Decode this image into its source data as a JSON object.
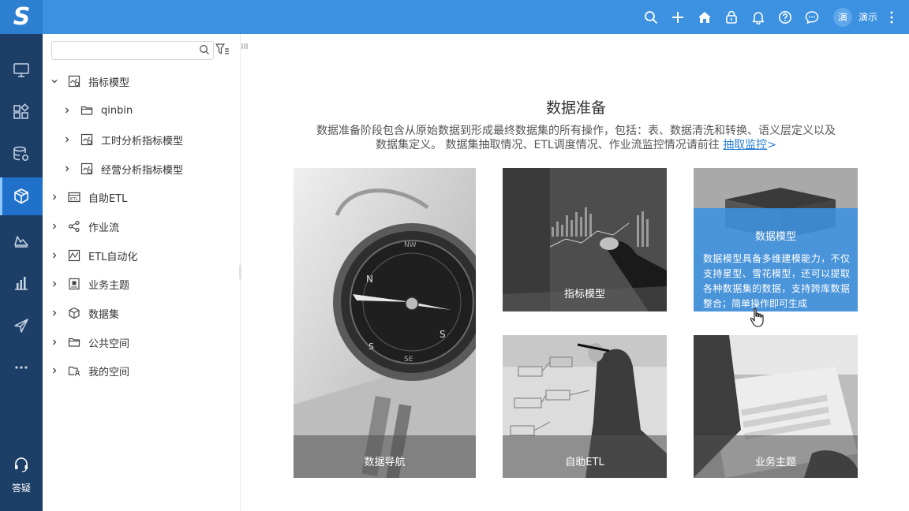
{
  "header": {
    "logo_letter": "S",
    "icons": [
      "search-icon",
      "plus-icon",
      "home-icon",
      "lock-icon",
      "bell-icon",
      "help-icon",
      "message-icon"
    ],
    "user": {
      "avatar_char": "演",
      "name": "演示"
    }
  },
  "leftnav": {
    "items": [
      {
        "name": "monitor-icon"
      },
      {
        "name": "grid-icon"
      },
      {
        "name": "database-settings-icon"
      },
      {
        "name": "cube-icon",
        "active": true
      },
      {
        "name": "layers-icon"
      },
      {
        "name": "bar-chart-icon"
      },
      {
        "name": "send-icon"
      },
      {
        "name": "more-icon"
      }
    ],
    "help_label": "答疑"
  },
  "tree": {
    "search": {
      "value": "",
      "placeholder": ""
    },
    "items": [
      {
        "label": "指标模型",
        "expanded": true,
        "level": 0,
        "icon": "metric-model-icon"
      },
      {
        "label": "qinbin",
        "expanded": false,
        "level": 1,
        "icon": "folder-icon"
      },
      {
        "label": "工时分析指标模型",
        "expanded": false,
        "level": 1,
        "icon": "metric-model-icon"
      },
      {
        "label": "经营分析指标模型",
        "expanded": false,
        "level": 1,
        "icon": "metric-model-icon"
      },
      {
        "label": "自助ETL",
        "expanded": false,
        "level": 0,
        "icon": "etl-icon"
      },
      {
        "label": "作业流",
        "expanded": false,
        "level": 0,
        "icon": "workflow-icon"
      },
      {
        "label": "ETL自动化",
        "expanded": false,
        "level": 0,
        "icon": "etl-automation-icon"
      },
      {
        "label": "业务主题",
        "expanded": false,
        "level": 0,
        "icon": "business-topic-icon"
      },
      {
        "label": "数据集",
        "expanded": false,
        "level": 0,
        "icon": "dataset-icon"
      },
      {
        "label": "公共空间",
        "expanded": false,
        "level": 0,
        "icon": "folder-icon"
      },
      {
        "label": "我的空间",
        "expanded": false,
        "level": 0,
        "icon": "my-space-icon"
      }
    ]
  },
  "main": {
    "title": "数据准备",
    "desc_line1": "数据准备阶段包含从原始数据到形成最终数据集的所有操作，包括：表、数据清洗和转换、语义层定义以及",
    "desc_line2": "数据集定义。 数据集抽取情况、ETL调度情况、作业流监控情况请前往 ",
    "link": "抽取监控",
    "link_arrow": ">",
    "cards": {
      "navigation": "数据导航",
      "metric_model": "指标模型",
      "data_model": {
        "title": "数据模型",
        "desc": "数据模型具备多维建模能力，不仅支持星型、雪花模型，还可以提取各种数据集的数据，支持跨库数据整合；简单操作即可生成"
      },
      "self_etl": "自助ETL",
      "business_topic": "业务主题"
    }
  }
}
